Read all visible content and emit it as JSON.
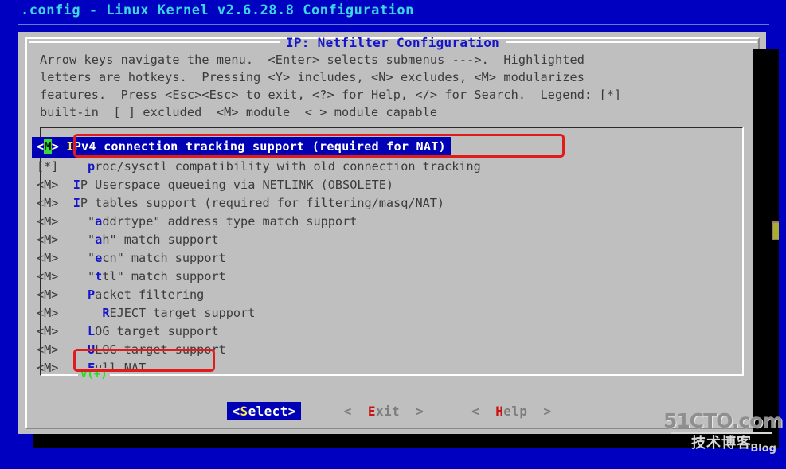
{
  "window": {
    "title": ".config - Linux Kernel v2.6.28.8 Configuration",
    "background_color": "#0000c0",
    "title_color": "#3ad7e8"
  },
  "dialog": {
    "title": "IP: Netfilter Configuration",
    "title_color": "#1414c8",
    "background_color": "#bfbfbf",
    "instructions": [
      "Arrow keys navigate the menu.  <Enter> selects submenus --->.  Highlighted",
      "letters are hotkeys.  Pressing <Y> includes, <N> excludes, <M> modularizes",
      "features.  Press <Esc><Esc> to exit, <?> for Help, </> for Search.  Legend: [*]",
      "built-in  [ ] excluded  <M> module  < > module capable"
    ]
  },
  "menu": {
    "selected_index": 0,
    "cursor_char": "M",
    "scroll_indicator": "v(+)",
    "scroll_indicator_color": "#1ee11e",
    "items": [
      {
        "marker": "<M>",
        "indent": "",
        "hotkey": "I",
        "pre": "",
        "post": "Pv4 connection tracking support (required for NAT)",
        "full_label": "IPv4 connection tracking support (required for NAT)",
        "selected": true
      },
      {
        "marker": "[*]",
        "indent": "   ",
        "hotkey": "p",
        "pre": "",
        "post": "roc/sysctl compatibility with old connection tracking",
        "full_label": "proc/sysctl compatibility with old connection tracking",
        "selected": false
      },
      {
        "marker": "<M>",
        "indent": " ",
        "hotkey": "I",
        "pre": "",
        "post": "P Userspace queueing via NETLINK (OBSOLETE)",
        "full_label": "IP Userspace queueing via NETLINK (OBSOLETE)",
        "selected": false
      },
      {
        "marker": "<M>",
        "indent": " ",
        "hotkey": "I",
        "pre": "",
        "post": "P tables support (required for filtering/masq/NAT)",
        "full_label": "IP tables support (required for filtering/masq/NAT)",
        "selected": false
      },
      {
        "marker": "<M>",
        "indent": "   ",
        "hotkey": "a",
        "pre": "\"",
        "post": "ddrtype\" address type match support",
        "full_label": "\"addrtype\" address type match support",
        "selected": false
      },
      {
        "marker": "<M>",
        "indent": "   ",
        "hotkey": "a",
        "pre": "\"",
        "post": "h\" match support",
        "full_label": "\"ah\" match support",
        "selected": false
      },
      {
        "marker": "<M>",
        "indent": "   ",
        "hotkey": "e",
        "pre": "\"",
        "post": "cn\" match support",
        "full_label": "\"ecn\" match support",
        "selected": false
      },
      {
        "marker": "<M>",
        "indent": "   ",
        "hotkey": "t",
        "pre": "\"",
        "post": "tl\" match support",
        "full_label": "\"ttl\" match support",
        "selected": false
      },
      {
        "marker": "<M>",
        "indent": "   ",
        "hotkey": "P",
        "pre": "",
        "post": "acket filtering",
        "full_label": "Packet filtering",
        "selected": false
      },
      {
        "marker": "<M>",
        "indent": "     ",
        "hotkey": "R",
        "pre": "",
        "post": "EJECT target support",
        "full_label": "REJECT target support",
        "selected": false
      },
      {
        "marker": "<M>",
        "indent": "   ",
        "hotkey": "L",
        "pre": "",
        "post": "OG target support",
        "full_label": "LOG target support",
        "selected": false
      },
      {
        "marker": "<M>",
        "indent": "   ",
        "hotkey": "U",
        "pre": "",
        "post": "LOG target support",
        "full_label": "ULOG target support",
        "selected": false
      },
      {
        "marker": "<M>",
        "indent": "   ",
        "hotkey": "F",
        "pre": "",
        "post": "ull NAT",
        "full_label": "Full NAT",
        "selected": false
      }
    ]
  },
  "buttons": [
    {
      "prefix": "<",
      "hotkey": "S",
      "rest": "elect>",
      "label": "<Select>",
      "active": true
    },
    {
      "prefix": "<  ",
      "hotkey": "E",
      "rest": "xit  >",
      "label": "<  Exit  >",
      "active": false
    },
    {
      "prefix": "<  ",
      "hotkey": "H",
      "rest": "elp  >",
      "label": "<  Help  >",
      "active": false
    }
  ],
  "annotations": {
    "color": "#e01b1b",
    "boxes": [
      {
        "target": "IPv4 connection tracking support (required for NAT)"
      },
      {
        "target": "Full NAT"
      }
    ]
  },
  "watermark": {
    "line1": "51CTO.com",
    "line2": "技术博客",
    "badge": "Blog"
  }
}
